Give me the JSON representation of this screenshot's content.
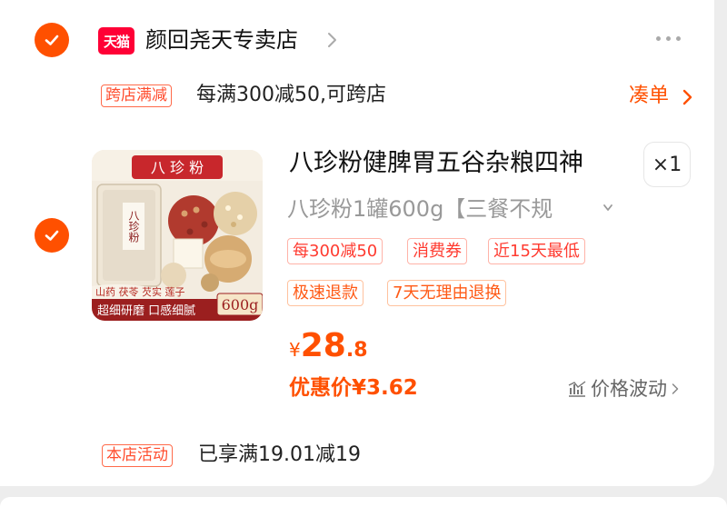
{
  "store": {
    "logo_text": "天猫",
    "name": "颜回尧天专卖店"
  },
  "promo": {
    "tag": "跨店满减",
    "text": "每满300减50,可跨店",
    "coudan": "凑单"
  },
  "product": {
    "title": "八珍粉健脾胃五谷杂粮四神",
    "sku": "八珍粉1罐600g【三餐不规",
    "qty": "×1",
    "image": {
      "label_top": "八 珍 粉",
      "jar_label": "八珍粉",
      "ingredients": "山药 茯苓 芡实 莲子",
      "bottom": "超细研磨 口感细腻",
      "weight": "600g"
    },
    "tags_row1": [
      "每300减50",
      "消费券",
      "近15天最低"
    ],
    "tags_row2": [
      "极速退款",
      "7天无理由退换"
    ],
    "price": {
      "currency": "¥",
      "int": "28",
      "dec": ".8"
    },
    "discount": "优惠价¥3.62",
    "trend": "价格波动"
  },
  "activity": {
    "tag": "本店活动",
    "text": "已享满19.01减19"
  },
  "colors": {
    "accent": "#ff5000",
    "tmall": "#ff0036"
  }
}
